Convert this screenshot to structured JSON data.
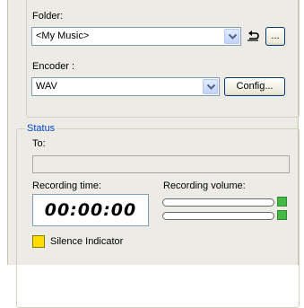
{
  "folder": {
    "label": "Folder:",
    "value": "<My Music>",
    "reset_icon": "undo-arrow-icon",
    "browse_label": "..."
  },
  "encoder": {
    "label": "Encoder :",
    "value": "WAV",
    "config_label": "Config..."
  },
  "status": {
    "title": "Status",
    "to_label": "To:",
    "to_value": "",
    "recording_time_label": "Recording time:",
    "recording_time_value": "00:00:00",
    "recording_volume_label": "Recording volume:",
    "volume_left_level": 0,
    "volume_right_level": 0,
    "led_color": "#45b845",
    "silence_label": "Silence Indicator",
    "silence_color": "#ffdd00"
  }
}
